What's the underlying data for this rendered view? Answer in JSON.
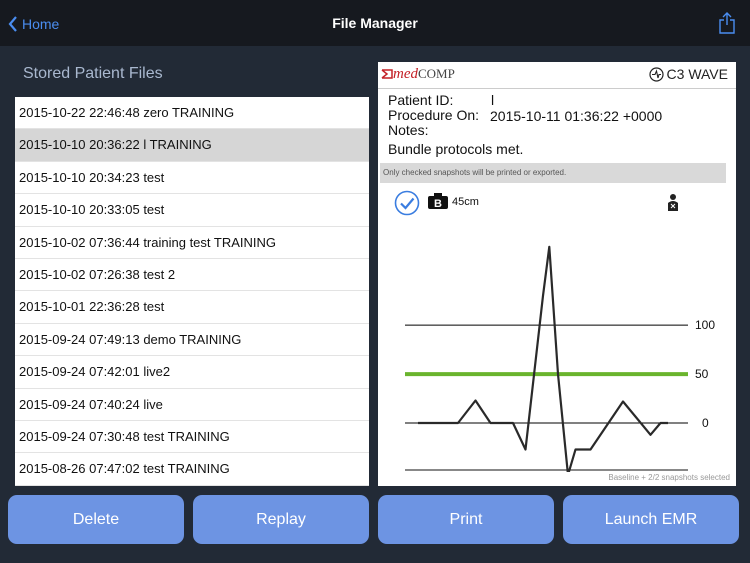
{
  "nav": {
    "back_label": "Home",
    "title": "File Manager"
  },
  "left": {
    "title": "Stored Patient Files",
    "files": [
      "2015-10-22 22:46:48 zero TRAINING",
      "2015-10-10 20:36:22 l TRAINING",
      "2015-10-10 20:34:23 test",
      "2015-10-10 20:33:05 test",
      "2015-10-02 07:36:44 training test TRAINING",
      "2015-10-02 07:26:38 test 2",
      "2015-10-01 22:36:28 test",
      "2015-09-24 07:49:13 demo TRAINING",
      "2015-09-24 07:42:01 live2",
      "2015-09-24 07:40:24 live",
      "2015-09-24 07:30:48 test TRAINING",
      "2015-08-26 07:47:02 test TRAINING"
    ],
    "selected_index": 1
  },
  "preview": {
    "brand_prefix": "med",
    "brand_suffix": "COMP",
    "product_name": "C3 WAVE",
    "patient_id_label": "Patient ID:",
    "patient_id_value": "l",
    "procedure_label": "Procedure On:",
    "procedure_value": "2015-10-11 01:36:22 +0000",
    "notes_label": "Notes:",
    "notes_value": "Bundle protocols met.",
    "snapshot_note": "Only checked snapshots will be printed or exported.",
    "depth": "45cm",
    "camera_label": "B",
    "footer": "Baseline + 2/2 snapshots selected",
    "checked": true
  },
  "chart_data": {
    "type": "line",
    "y_levels": [
      {
        "label": "100",
        "value": 100,
        "color": "#000000"
      },
      {
        "label": "50",
        "value": 50,
        "color": "#6ab42d"
      },
      {
        "label": "0",
        "value": 0,
        "color": "#000000"
      }
    ],
    "ylim": [
      -50,
      190
    ],
    "x": [
      0,
      0.16,
      0.23,
      0.29,
      0.38,
      0.43,
      0.5,
      0.525,
      0.56,
      0.6,
      0.63,
      0.69,
      0.82,
      0.93,
      0.97,
      1.0
    ],
    "y": [
      0,
      0,
      23,
      0,
      0,
      -27,
      130,
      180,
      50,
      -53,
      -27,
      -27,
      22,
      -12,
      0,
      0
    ],
    "series_color": "#2a2a2a"
  },
  "actions": {
    "delete": "Delete",
    "replay": "Replay",
    "print": "Print",
    "launch": "Launch EMR"
  },
  "colors": {
    "accent": "#4a8df0",
    "button": "#6d94e3",
    "background": "#222a36",
    "brand_red": "#c42127"
  }
}
